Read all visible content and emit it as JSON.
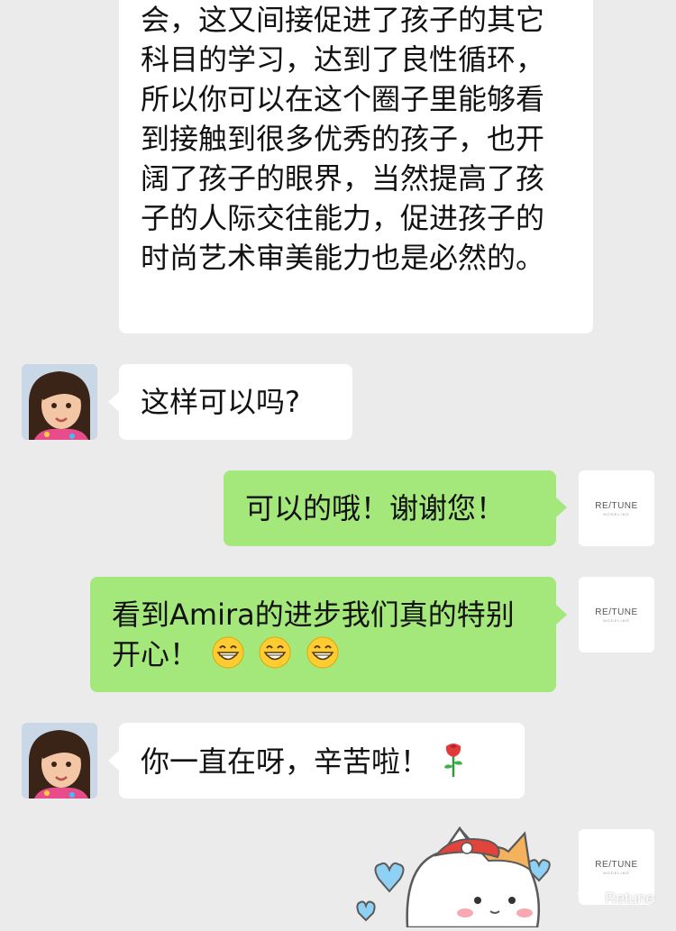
{
  "brand": {
    "name": "RE/TUNE",
    "tagline": "MODELING"
  },
  "messages": [
    {
      "side": "in",
      "text": "会，这又间接促进了孩子的其它科目的学习，达到了良性循环，所以你可以在这个圈子里能够看到接触到很多优秀的孩子，也开阔了孩子的眼界，当然提高了孩子的人际交往能力，促进孩子的时尚艺术审美能力也是必然的。"
    },
    {
      "side": "in",
      "text": "这样可以吗?"
    },
    {
      "side": "out",
      "text": "可以的哦！谢谢您！"
    },
    {
      "side": "out",
      "text": "看到Amira的进步我们真的特别开心！",
      "emoji": "grin-emoji x3"
    },
    {
      "side": "in",
      "text": "你一直在呀，辛苦啦！",
      "emoji": "rose-emoji"
    }
  ],
  "watermark": {
    "text": "Retune"
  },
  "colors": {
    "background": "#ebebeb",
    "incoming": "#ffffff",
    "outgoing": "#a4e77b"
  }
}
